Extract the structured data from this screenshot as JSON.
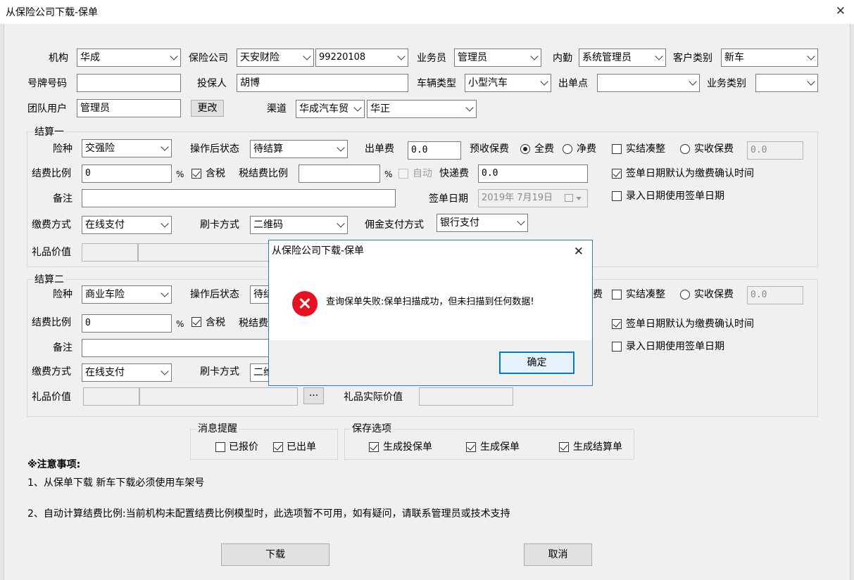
{
  "window": {
    "title": "从保险公司下载-保单",
    "close_glyph": "✕"
  },
  "row1": {
    "org_label": "机构",
    "org_value": "华成",
    "ins_label": "保险公司",
    "ins_value": "天安财险",
    "ins_code": "99220108",
    "sales_label": "业务员",
    "sales_value": "管理员",
    "staff_label": "内勤",
    "staff_value": "系统管理员",
    "ctype_label": "客户类别",
    "ctype_value": "新车"
  },
  "row2": {
    "plate_label": "号牌号码",
    "plate_value": "",
    "holder_label": "投保人",
    "holder_value": "胡博",
    "vtype_label": "车辆类型",
    "vtype_value": "小型汽车",
    "point_label": "出单点",
    "point_value": "",
    "btype_label": "业务类别",
    "btype_value": ""
  },
  "row3": {
    "team_label": "团队用户",
    "team_value": "管理员",
    "change_btn": "更改",
    "channel_label": "渠道",
    "channel_value1": "华成汽车贸",
    "channel_value2": "华正"
  },
  "s1": {
    "title": "结算一",
    "risk_label": "险种",
    "risk_value": "交强险",
    "after_label": "操作后状态",
    "after_value": "待结算",
    "fee_label": "出单费",
    "fee_value": "0.0",
    "pre_label": "预收保费",
    "full_label": "全费",
    "net_label": "净费",
    "round_label": "实结凑整",
    "actual_label": "实收保费",
    "actual_value": "0.0",
    "ratio_label": "结费比例",
    "ratio_value": "0",
    "pct": "%",
    "tax_label": "含税",
    "taxratio_label": "税结费比例",
    "taxratio_value": "",
    "pct2": "%",
    "auto_label": "自动",
    "express_label": "快递费",
    "express_value": "0.0",
    "signdef_label": "签单日期默认为缴费确认时间",
    "note_label": "备注",
    "note_value": "",
    "signdate_label": "签单日期",
    "signdate_value": "2019年  7月19日",
    "entry_label": "录入日期使用签单日期",
    "pay_label": "缴费方式",
    "pay_value": "在线支付",
    "card_label": "刷卡方式",
    "card_value": "二维码",
    "comm_label": "佣金支付方式",
    "comm_value": "银行支付",
    "gift_label": "礼品价值"
  },
  "s2": {
    "title": "结算二",
    "risk_label": "险种",
    "risk_value": "商业车险",
    "after_label": "操作后状态",
    "after_value": "待结",
    "fee_tail": "费",
    "round_label": "实结凑整",
    "actual_label": "实收保费",
    "actual_value": "0.0",
    "ratio_label": "结费比例",
    "ratio_value": "0",
    "pct": "%",
    "tax_label": "含税",
    "taxratio_label": "税结费",
    "signdef_label": "签单日期默认为缴费确认时间",
    "note_label": "备注",
    "entry_label": "录入日期使用签单日期",
    "pay_label": "缴费方式",
    "pay_value": "在线支付",
    "card_label": "刷卡方式",
    "card_value": "二维",
    "gift_label": "礼品价值",
    "more_btn": "···",
    "giftreal_label": "礼品实际价值"
  },
  "msg": {
    "title": "消息提醒",
    "quoted": "已报价",
    "issued": "已出单"
  },
  "save": {
    "title": "保存选项",
    "gen_app": "生成投保单",
    "gen_policy": "生成保单",
    "gen_settle": "生成结算单"
  },
  "notes": {
    "heading": "※注意事项:",
    "line1": "1、从保单下载 新车下载必须使用车架号",
    "line2": "2、自动计算结费比例:当前机构未配置结费比例模型时，此选项暂不可用，如有疑问，请联系管理员或技术支持"
  },
  "actions": {
    "download": "下载",
    "cancel": "取消"
  },
  "dialog": {
    "title": "从保险公司下载-保单",
    "message": "查询保单失败:保单扫描成功，但未扫描到任何数据!",
    "ok": "确定",
    "close_glyph": "✕"
  }
}
